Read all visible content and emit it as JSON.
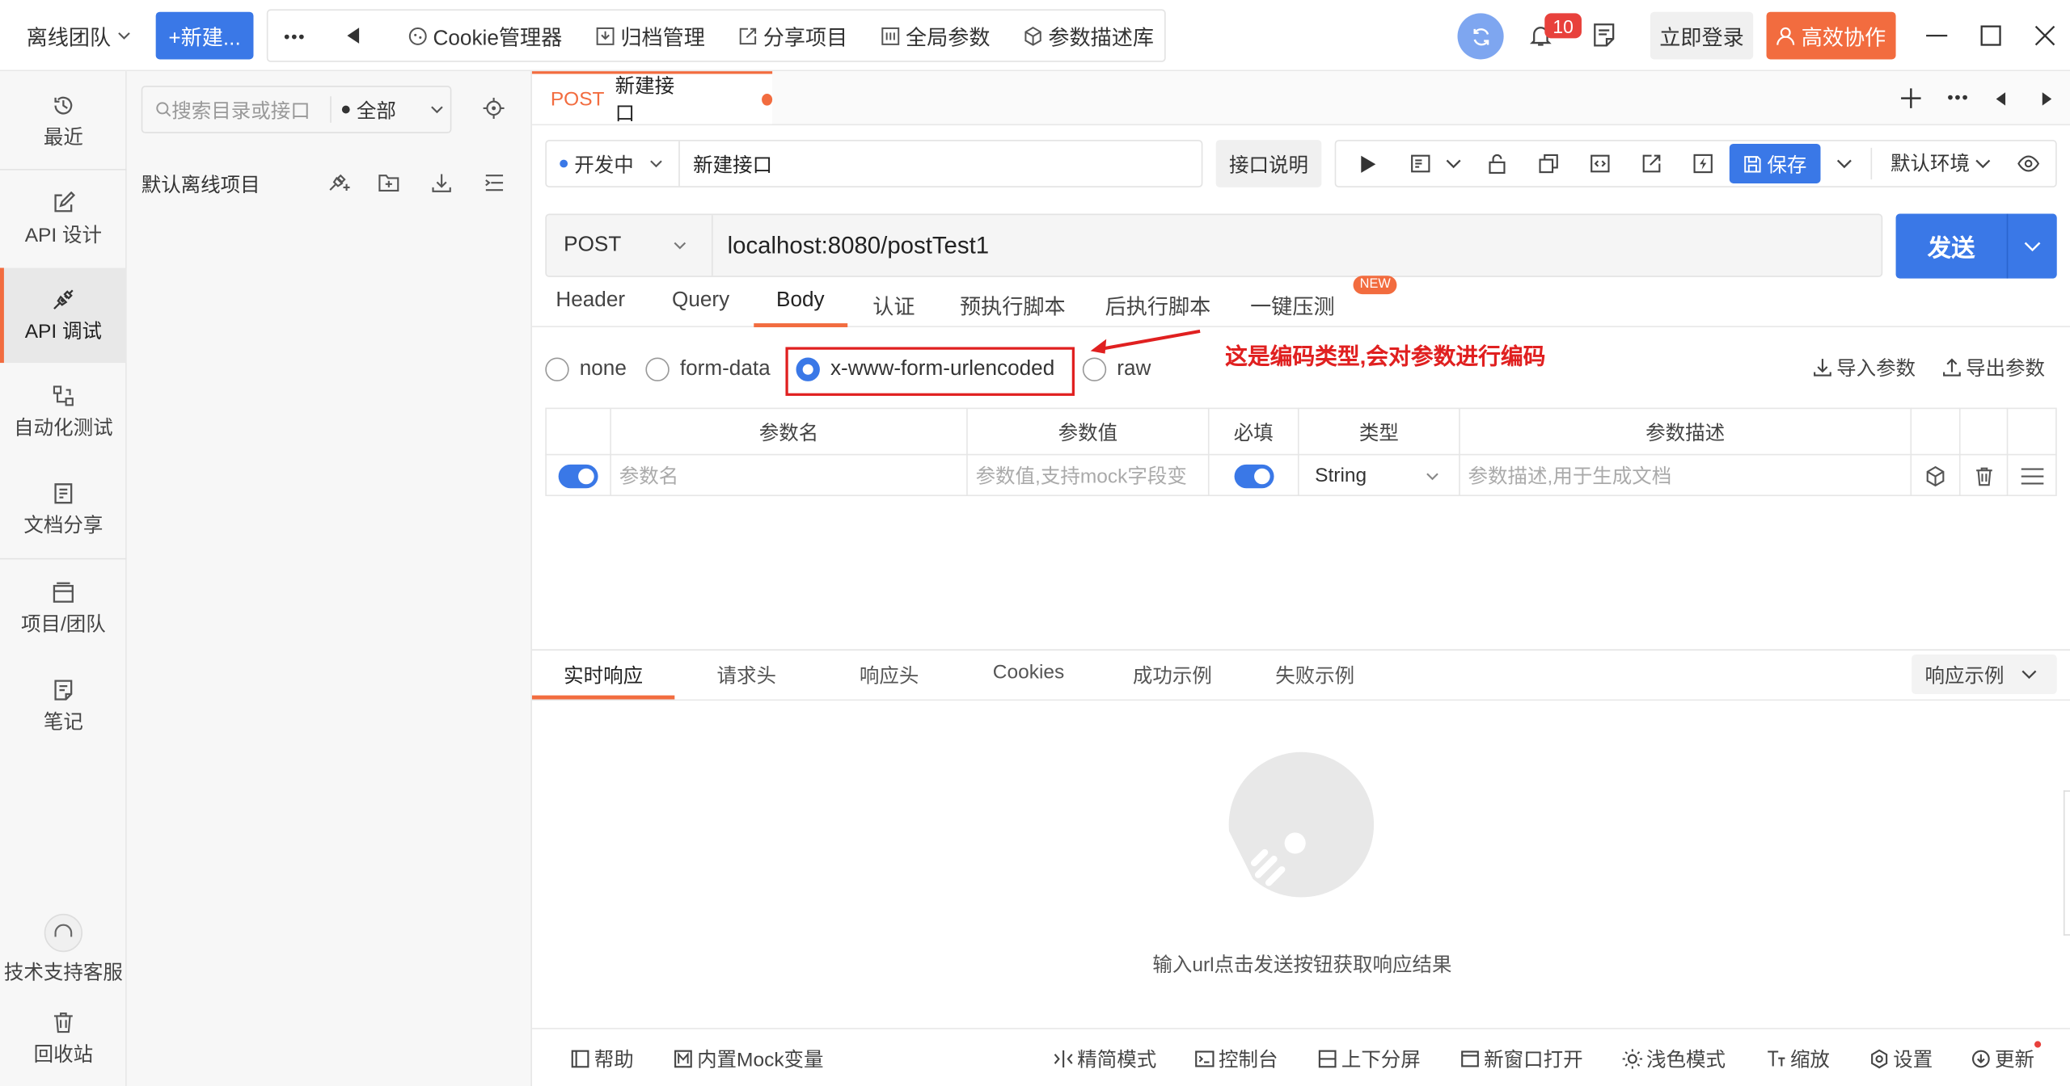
{
  "topbar": {
    "team": "离线团队",
    "new_label": "+新建...",
    "more": "•••",
    "tools": [
      "Cookie管理器",
      "归档管理",
      "分享项目",
      "全局参数",
      "参数描述库"
    ],
    "notif_count": "10",
    "login": "立即登录",
    "collab": "高效协作"
  },
  "sidebar": {
    "items": [
      "最近",
      "API 设计",
      "API 调试",
      "自动化测试",
      "文档分享",
      "项目/团队",
      "笔记"
    ],
    "support": "技术支持客服",
    "trash": "回收站"
  },
  "tree": {
    "search_placeholder": "搜索目录或接口",
    "filter": "全部",
    "project": "默认离线项目"
  },
  "tab": {
    "method": "POST",
    "name": "新建接口"
  },
  "request": {
    "status": "开发中",
    "name": "新建接口",
    "doc_btn": "接口说明",
    "save": "保存",
    "env": "默认环境",
    "method": "POST",
    "url": "localhost:8080/postTest1",
    "send": "发送"
  },
  "subtabs": [
    "Header",
    "Query",
    "Body",
    "认证",
    "预执行脚本",
    "后执行脚本",
    "一键压测"
  ],
  "new_badge": "NEW",
  "body_types": [
    "none",
    "form-data",
    "x-www-form-urlencoded",
    "raw"
  ],
  "annotation": "这是编码类型,会对参数进行编码",
  "import_params": "导入参数",
  "export_params": "导出参数",
  "table": {
    "headers": [
      "参数名",
      "参数值",
      "必填",
      "类型",
      "参数描述"
    ],
    "row": {
      "name_placeholder": "参数名",
      "value_placeholder": "参数值,支持mock字段变",
      "type": "String",
      "desc_placeholder": "参数描述,用于生成文档"
    }
  },
  "response": {
    "tabs": [
      "实时响应",
      "请求头",
      "响应头",
      "Cookies",
      "成功示例",
      "失败示例"
    ],
    "example_btn": "响应示例",
    "empty_text": "输入url点击发送按钮获取响应结果"
  },
  "footer": {
    "left": [
      "帮助",
      "内置Mock变量"
    ],
    "right": [
      "精简模式",
      "控制台",
      "上下分屏",
      "新窗口打开",
      "浅色模式",
      "缩放",
      "设置",
      "更新"
    ]
  },
  "colors": {
    "accent": "#3a78e7",
    "brand": "#f26c3f",
    "annotation": "#e02020"
  }
}
